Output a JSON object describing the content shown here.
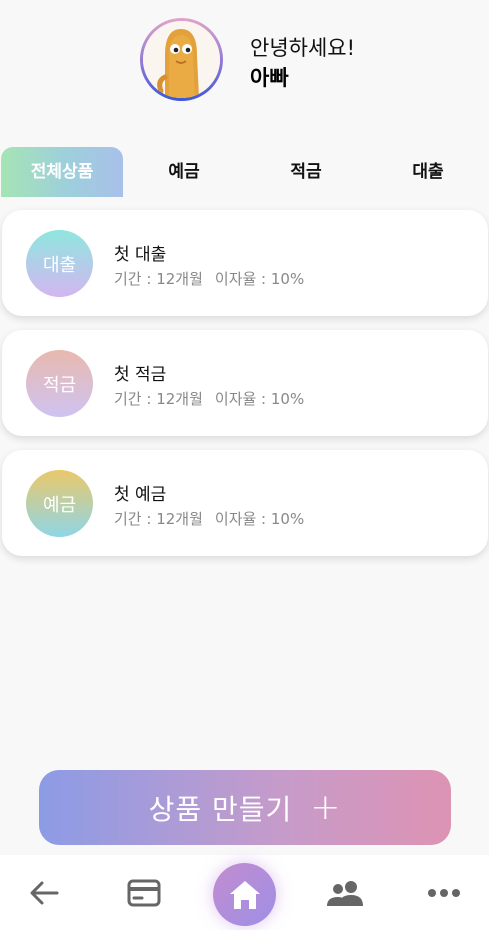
{
  "header": {
    "greeting": "안녕하세요!",
    "username": "아빠"
  },
  "tabs": [
    {
      "label": "전체상품",
      "active": true
    },
    {
      "label": "예금",
      "active": false
    },
    {
      "label": "적금",
      "active": false
    },
    {
      "label": "대출",
      "active": false
    }
  ],
  "products": [
    {
      "type_label": "대출",
      "name": "첫 대출",
      "term": "기간 : 12개월",
      "rate": "이자율 : 10%"
    },
    {
      "type_label": "적금",
      "name": "첫 적금",
      "term": "기간 : 12개월",
      "rate": "이자율 : 10%"
    },
    {
      "type_label": "예금",
      "name": "첫 예금",
      "term": "기간 : 12개월",
      "rate": "이자율 : 10%"
    }
  ],
  "create_button": {
    "label": "상품 만들기",
    "plus": "+"
  },
  "nav": [
    {
      "icon": "arrow-left-icon"
    },
    {
      "icon": "card-icon"
    },
    {
      "icon": "home-icon",
      "active": true
    },
    {
      "icon": "people-icon"
    },
    {
      "icon": "more-icon"
    }
  ],
  "colors": {
    "loan_gradient": [
      "#8fe6df",
      "#d3b6f0"
    ],
    "savings_gradient": [
      "#e8b9ad",
      "#cfc3f3"
    ],
    "deposit_gradient": [
      "#eac86a",
      "#8fd6e6"
    ],
    "nav_icon": "#666666"
  }
}
